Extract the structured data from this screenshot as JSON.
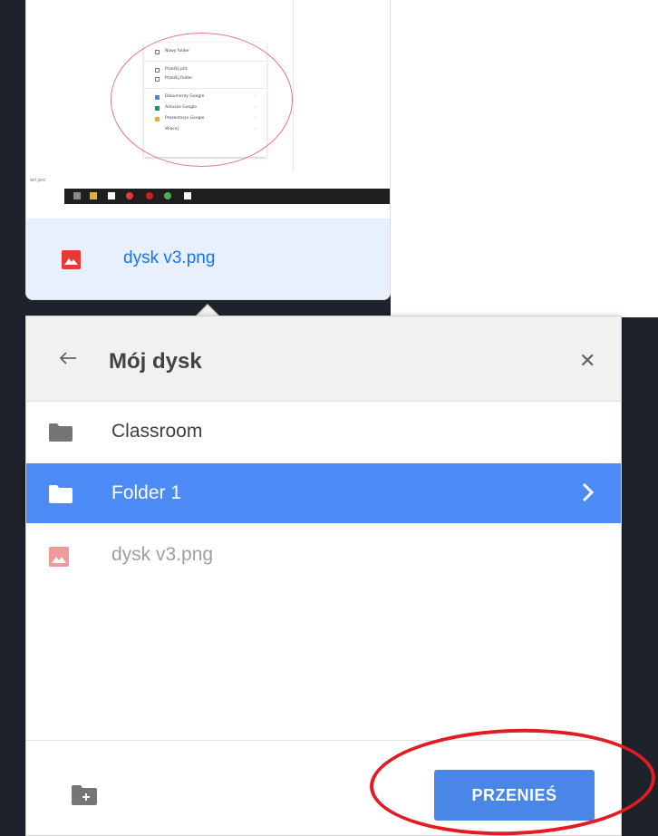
{
  "file_card": {
    "file_name": "dysk v3.png",
    "thumbnail": {
      "caption": "wrl.pro",
      "menu_items": [
        {
          "label": "Nowy folder",
          "has_arrow": false
        },
        {
          "label": "Prześlij plik",
          "has_arrow": false
        },
        {
          "label": "Prześlij folder",
          "has_arrow": false
        },
        {
          "label": "Dokumenty Google",
          "has_arrow": true
        },
        {
          "label": "Arkusze Google",
          "has_arrow": true
        },
        {
          "label": "Prezentacje Google",
          "has_arrow": true
        },
        {
          "label": "Więcej",
          "has_arrow": true
        }
      ]
    }
  },
  "dialog": {
    "title": "Mój dysk",
    "back_icon": "arrow-left-icon",
    "close_icon": "close-icon",
    "items": [
      {
        "label": "Classroom",
        "icon": "folder-icon",
        "state": "normal"
      },
      {
        "label": "Folder 1",
        "icon": "folder-icon",
        "state": "selected"
      },
      {
        "label": "dysk v3.png",
        "icon": "image-icon",
        "state": "disabled"
      }
    ],
    "new_folder_icon": "new-folder-icon",
    "move_button": "PRZENIEŚ"
  },
  "colors": {
    "accent": "#4c8bf5",
    "button": "#4a86e8",
    "file_name": "#1a73e8",
    "annotation": "#e31b23",
    "image_icon": "#e53935"
  }
}
